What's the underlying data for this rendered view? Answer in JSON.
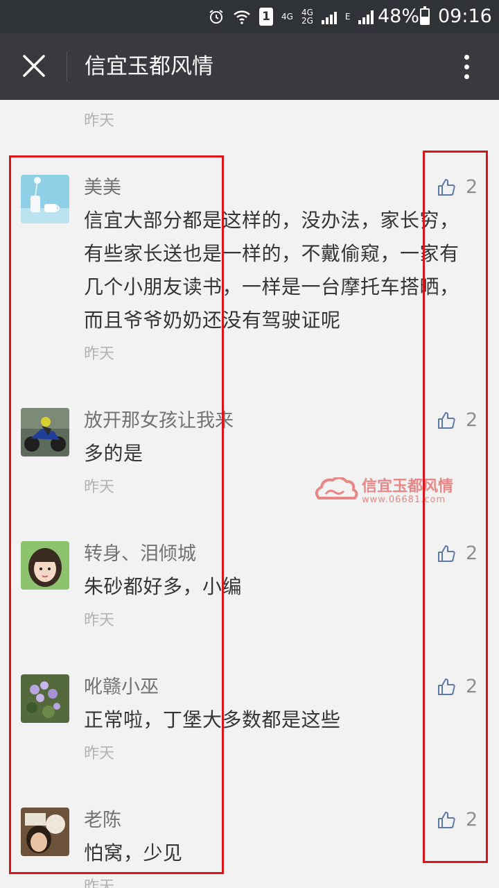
{
  "status_bar": {
    "battery_text": "48%",
    "battery_level": 0.48,
    "time": "09:16",
    "sim_label": "1",
    "net_4g": "4G",
    "net_4g2": "4G",
    "net_2g": "2G",
    "net_e": "E",
    "icons": [
      "alarm-icon",
      "wifi-icon",
      "sim-icon",
      "signal-icon",
      "battery-icon"
    ]
  },
  "appbar": {
    "title": "信宜玉都风情",
    "icons": [
      "close-icon",
      "more-vertical-icon"
    ]
  },
  "top_time": "昨天",
  "watermark": {
    "title": "信宜玉都风情",
    "url": "www.06681.com"
  },
  "comments": [
    {
      "name": "美美",
      "text": "信宜大部分都是这样的，没办法，家长穷，有些家长送也是一样的，不戴偷窥，一家有几个小朋友读书，一样是一台摩托车搭晒，而且爷爷奶奶还没有驾驶证呢",
      "time": "昨天",
      "likes": "2",
      "avatar_icon": "cup-avatar"
    },
    {
      "name": "放开那女孩让我来",
      "text": "多的是",
      "time": "昨天",
      "likes": "2",
      "avatar_icon": "motorcycle-avatar"
    },
    {
      "name": "转身、泪倾城",
      "text": "朱砂都好多，小编",
      "time": "昨天",
      "likes": "2",
      "avatar_icon": "girl-avatar"
    },
    {
      "name": "吪赣小巫",
      "text": "正常啦，丁堡大多数都是这些",
      "time": "昨天",
      "likes": "2",
      "avatar_icon": "flower-avatar"
    },
    {
      "name": "老陈",
      "text": "怕窝，少见",
      "time": "昨天",
      "likes": "2",
      "avatar_icon": "child-avatar"
    }
  ],
  "colors": {
    "status_bar_bg": "#2f3236",
    "appbar_bg": "#393a3f",
    "page_bg": "#f2f2f2",
    "highlight_box": "#d9141b",
    "like_icon": "#5a7aa8"
  }
}
